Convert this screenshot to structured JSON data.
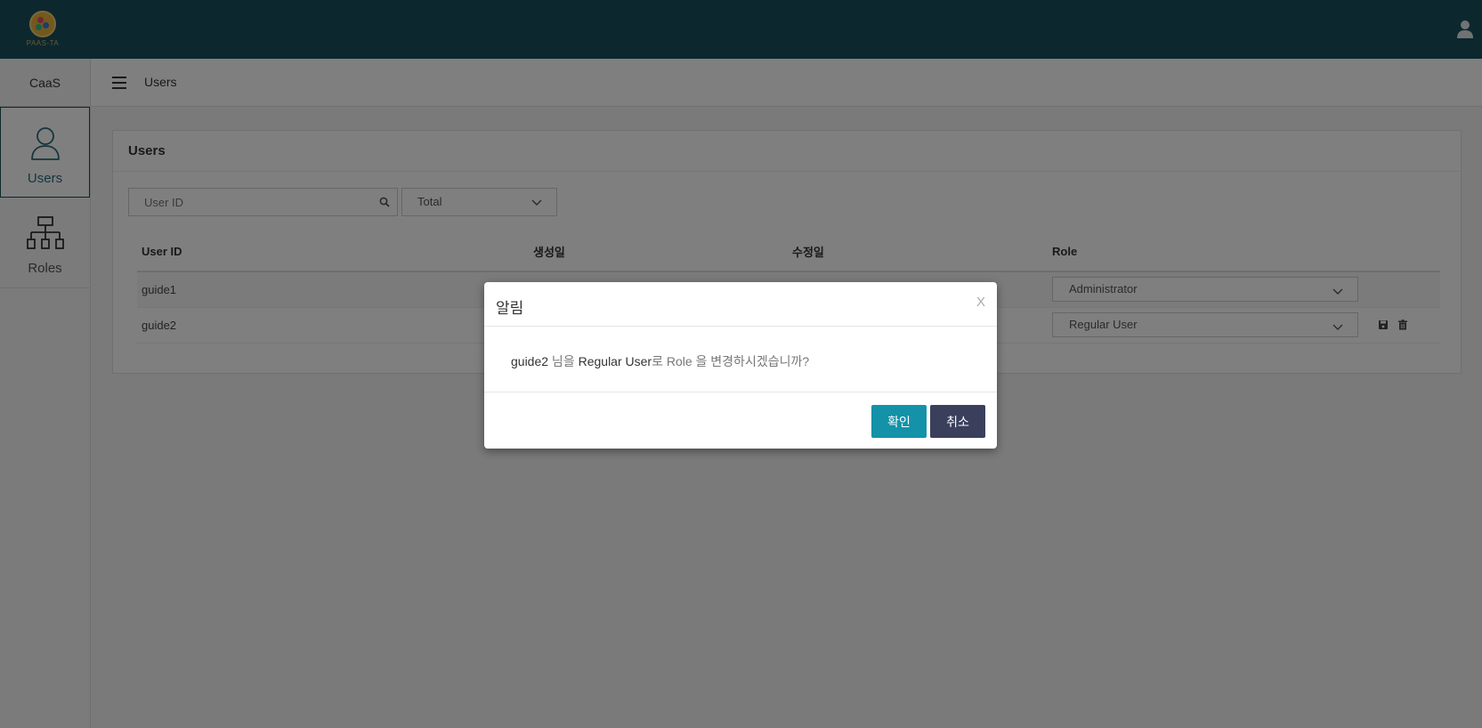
{
  "app": {
    "brand": "PAAS-TA",
    "module": "CaaS"
  },
  "sidebar": {
    "items": [
      {
        "label": "Users",
        "icon": "user-outline-icon",
        "active": true
      },
      {
        "label": "Roles",
        "icon": "hierarchy-icon",
        "active": false
      }
    ]
  },
  "header": {
    "title": "Users"
  },
  "panel": {
    "title": "Users",
    "search_placeholder": "User ID",
    "filter_selected": "Total"
  },
  "table": {
    "columns": [
      "User ID",
      "생성일",
      "수정일",
      "Role"
    ],
    "rows": [
      {
        "user_id": "guide1",
        "role": "Administrator"
      },
      {
        "user_id": "guide2",
        "role": "Regular User"
      }
    ]
  },
  "modal": {
    "title": "알림",
    "close": "X",
    "message_user": "guide2",
    "message_part1": " 님을 ",
    "message_role": "Regular User",
    "message_part2": "로 Role 을 변경하시겠습니까?",
    "confirm": "확인",
    "cancel": "취소"
  },
  "colors": {
    "topbar": "#1a4f5c",
    "confirm": "#1392a8",
    "cancel": "#3a3f5c"
  }
}
